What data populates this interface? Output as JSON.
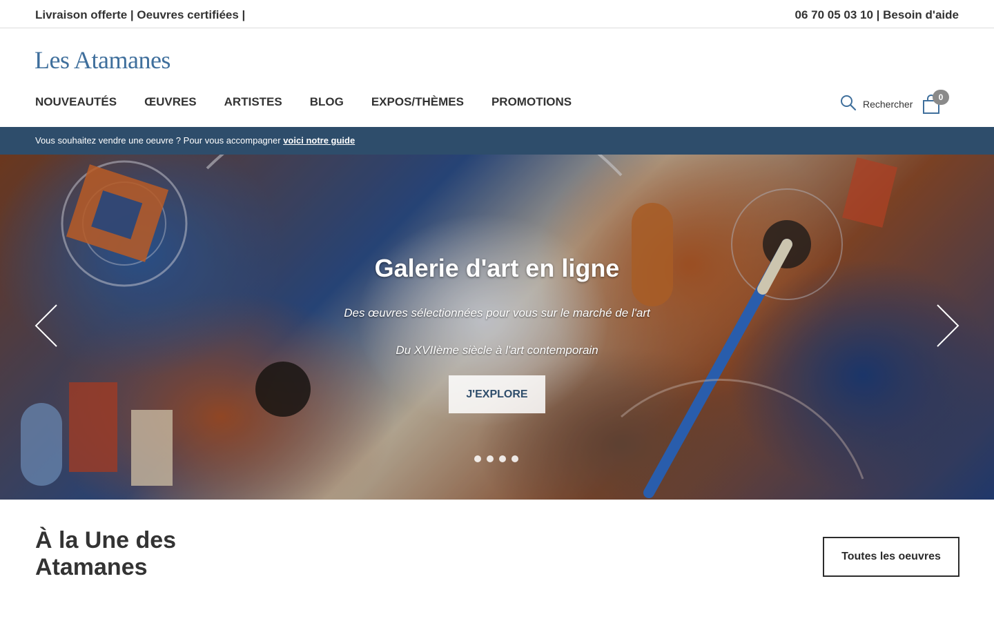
{
  "topbar": {
    "left_text": "Livraison offerte | Oeuvres certifiées |",
    "right_text": "06 70 05 03 10 | Besoin d'aide"
  },
  "logo": "Les Atamanes",
  "nav": {
    "items": [
      "NOUVEAUTÉS",
      "ŒUVRES",
      "ARTISTES",
      "BLOG",
      "EXPOS/THÈMES",
      "PROMOTIONS"
    ]
  },
  "search": {
    "label": "Rechercher",
    "icon": "search-icon"
  },
  "cart": {
    "count": "0",
    "icon": "shopping-bag-icon"
  },
  "sell_banner": {
    "text": "Vous souhaitez vendre une oeuvre ? Pour vous accompagner",
    "link": "voici notre guide"
  },
  "hero": {
    "title": "Galerie d'art en ligne",
    "subtitle1": "Des œuvres sélectionnées pour vous sur le marché de l'art",
    "subtitle2": "Du XVIIème siècle à l'art contemporain",
    "cta": "J'EXPLORE",
    "slide_count": 4
  },
  "featured": {
    "title": "À la Une des Atamanes",
    "button": "Toutes les oeuvres"
  },
  "colors": {
    "brand_blue": "#3f6f9c",
    "banner_bg": "#2e4d6b",
    "text_dark": "#2b2b2b"
  }
}
